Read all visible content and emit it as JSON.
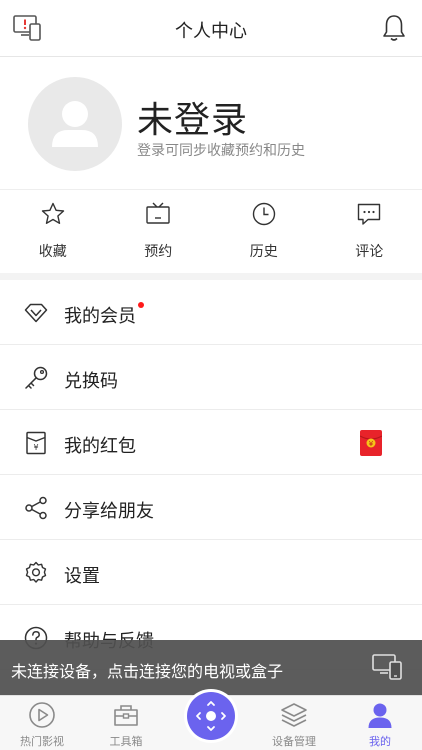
{
  "header": {
    "title": "个人中心",
    "left_icon": "device-warning-icon",
    "right_icon": "bell-icon"
  },
  "profile": {
    "name": "未登录",
    "subtitle": "登录可同步收藏预约和历史"
  },
  "quick_actions": [
    {
      "label": "收藏",
      "icon": "star-icon"
    },
    {
      "label": "预约",
      "icon": "tv-icon"
    },
    {
      "label": "历史",
      "icon": "clock-icon"
    },
    {
      "label": "评论",
      "icon": "comment-icon"
    }
  ],
  "menu": [
    {
      "label": "我的会员",
      "icon": "diamond-icon",
      "badge": "red-dot"
    },
    {
      "label": "兑换码",
      "icon": "key-icon"
    },
    {
      "label": "我的红包",
      "icon": "red-envelope-icon"
    },
    {
      "label": "分享给朋友",
      "icon": "share-icon"
    },
    {
      "label": "设置",
      "icon": "gear-icon"
    },
    {
      "label": "帮助与反馈",
      "icon": "help-icon"
    }
  ],
  "toast": {
    "text": "未连接设备，点击连接您的电视或盒子",
    "icon": "devices-icon"
  },
  "tabbar": [
    {
      "label": "热门影视",
      "icon": "play-circle-icon",
      "active": false
    },
    {
      "label": "工具箱",
      "icon": "toolbox-icon",
      "active": false
    },
    {
      "label": "",
      "icon": "remote-control-icon",
      "active": false
    },
    {
      "label": "设备管理",
      "icon": "layers-icon",
      "active": false
    },
    {
      "label": "我的",
      "icon": "user-icon",
      "active": true
    }
  ],
  "colors": {
    "accent": "#6b63ee",
    "badge": "#ff1a1a",
    "red_envelope": "#e8232a",
    "toast_bg": "#505050"
  }
}
